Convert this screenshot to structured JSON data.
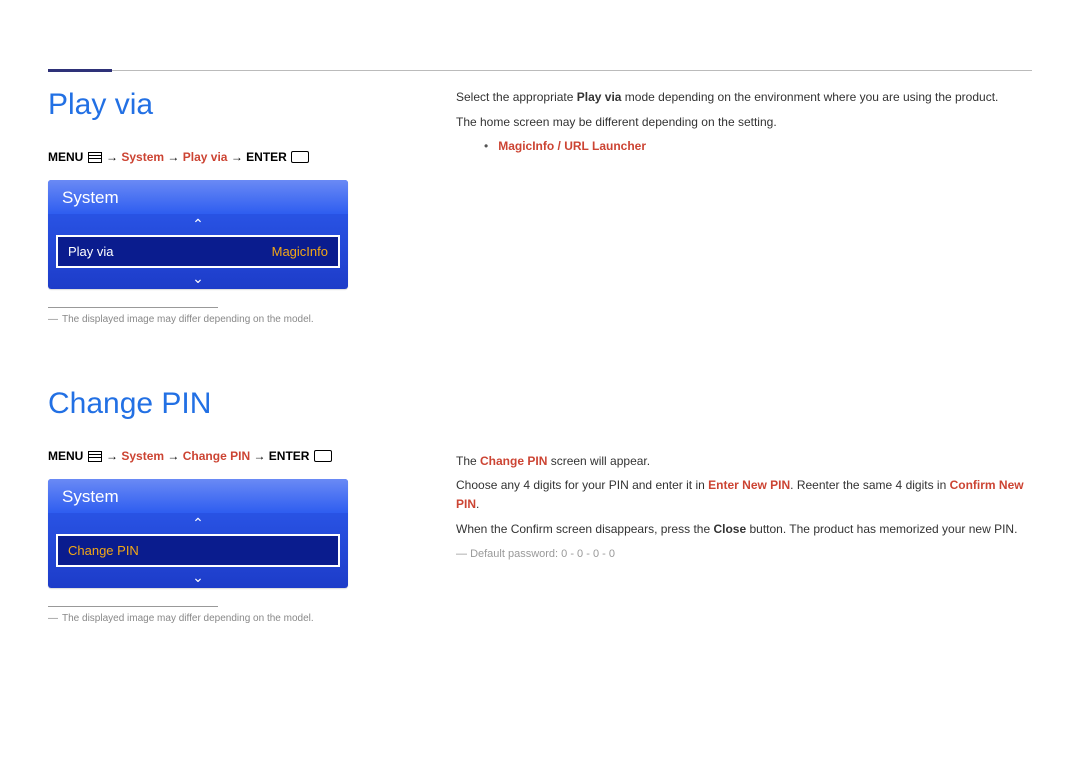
{
  "section1": {
    "heading": "Play via",
    "path": {
      "menu": "MENU",
      "arrow": " → ",
      "system": "System",
      "play_via": "Play via",
      "enter": "ENTER"
    },
    "osd": {
      "title": "System",
      "row_label": "Play via",
      "row_value": "MagicInfo"
    },
    "footnote": "The displayed image may differ depending on the model.",
    "right": {
      "line1a": "Select the appropriate ",
      "line1b": "Play via",
      "line1c": " mode depending on the environment where you are using the product.",
      "line2": "The home screen may be different depending on the setting.",
      "bullet": "MagicInfo / URL Launcher"
    }
  },
  "section2": {
    "heading": "Change PIN",
    "path": {
      "menu": "MENU",
      "arrow": " → ",
      "system": "System",
      "change_pin": "Change PIN",
      "enter": "ENTER"
    },
    "osd": {
      "title": "System",
      "row_label": "Change PIN"
    },
    "footnote": "The displayed image may differ depending on the model.",
    "right": {
      "l1a": "The ",
      "l1b": "Change PIN",
      "l1c": " screen will appear.",
      "l2a": "Choose any 4 digits for your PIN and enter it in ",
      "l2b": "Enter New PIN",
      "l2c": ". Reenter the same 4 digits in ",
      "l2d": "Confirm New PIN",
      "l2e": ".",
      "l3a": "When the Confirm screen disappears, press the ",
      "l3b": "Close",
      "l3c": " button. The product has memorized your new PIN.",
      "default_pw": "Default password: 0 - 0 - 0 - 0"
    }
  }
}
